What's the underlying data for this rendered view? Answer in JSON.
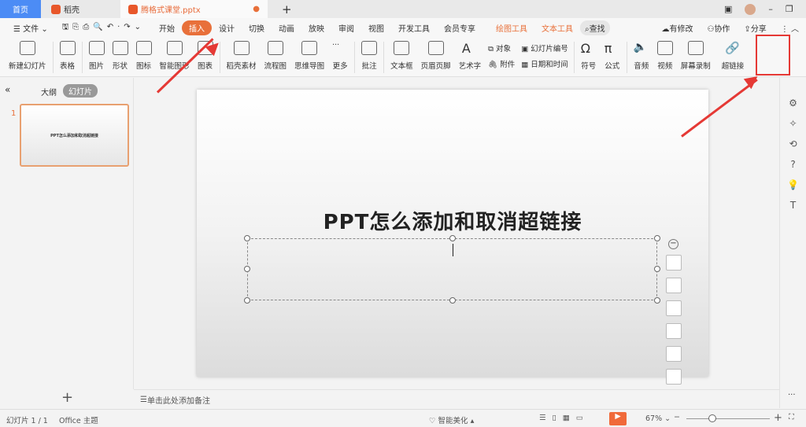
{
  "tabs": {
    "home": "首页",
    "daoke": "稻壳",
    "file": "腾格式课堂.pptx",
    "new": "+"
  },
  "menu": [
    "文件",
    "开始",
    "插入",
    "设计",
    "切换",
    "动画",
    "放映",
    "审阅",
    "视图",
    "开发工具",
    "会员专享",
    "绘图工具",
    "文本工具",
    "查找"
  ],
  "menu_right": [
    "有修改",
    "协作",
    "分享"
  ],
  "ribbon": {
    "new_slide": "新建幻灯片",
    "table": "表格",
    "picture": "图片",
    "shape": "形状",
    "icon": "图标",
    "smart": "智能图形",
    "chart": "图表",
    "daoke": "稻壳素材",
    "flow": "流程图",
    "mind": "思维导图",
    "more": "更多",
    "comment": "批注",
    "textbox": "文本框",
    "header": "页眉页脚",
    "art": "艺术字",
    "object": "对象",
    "attach": "附件",
    "slide_no": "幻灯片编号",
    "datetime": "日期和时间",
    "symbol": "符号",
    "formula": "公式",
    "audio": "音频",
    "video": "视频",
    "record": "屏幕录制",
    "hyperlink": "超链接"
  },
  "left": {
    "outline": "大纲",
    "slides": "幻灯片",
    "num": "1",
    "thumb_title": "PPT怎么添加和取消超链接",
    "add": "+"
  },
  "slide": {
    "title": "PPT怎么添加和取消超链接"
  },
  "notes": "单击此处添加备注",
  "status": {
    "slide": "幻灯片 1 / 1",
    "theme": "Office 主题",
    "beautify": "智能美化",
    "zoom": "67%"
  },
  "colors": {
    "accent": "#e8703a",
    "highlight": "#e53935",
    "home_tab": "#4c8cf5"
  }
}
